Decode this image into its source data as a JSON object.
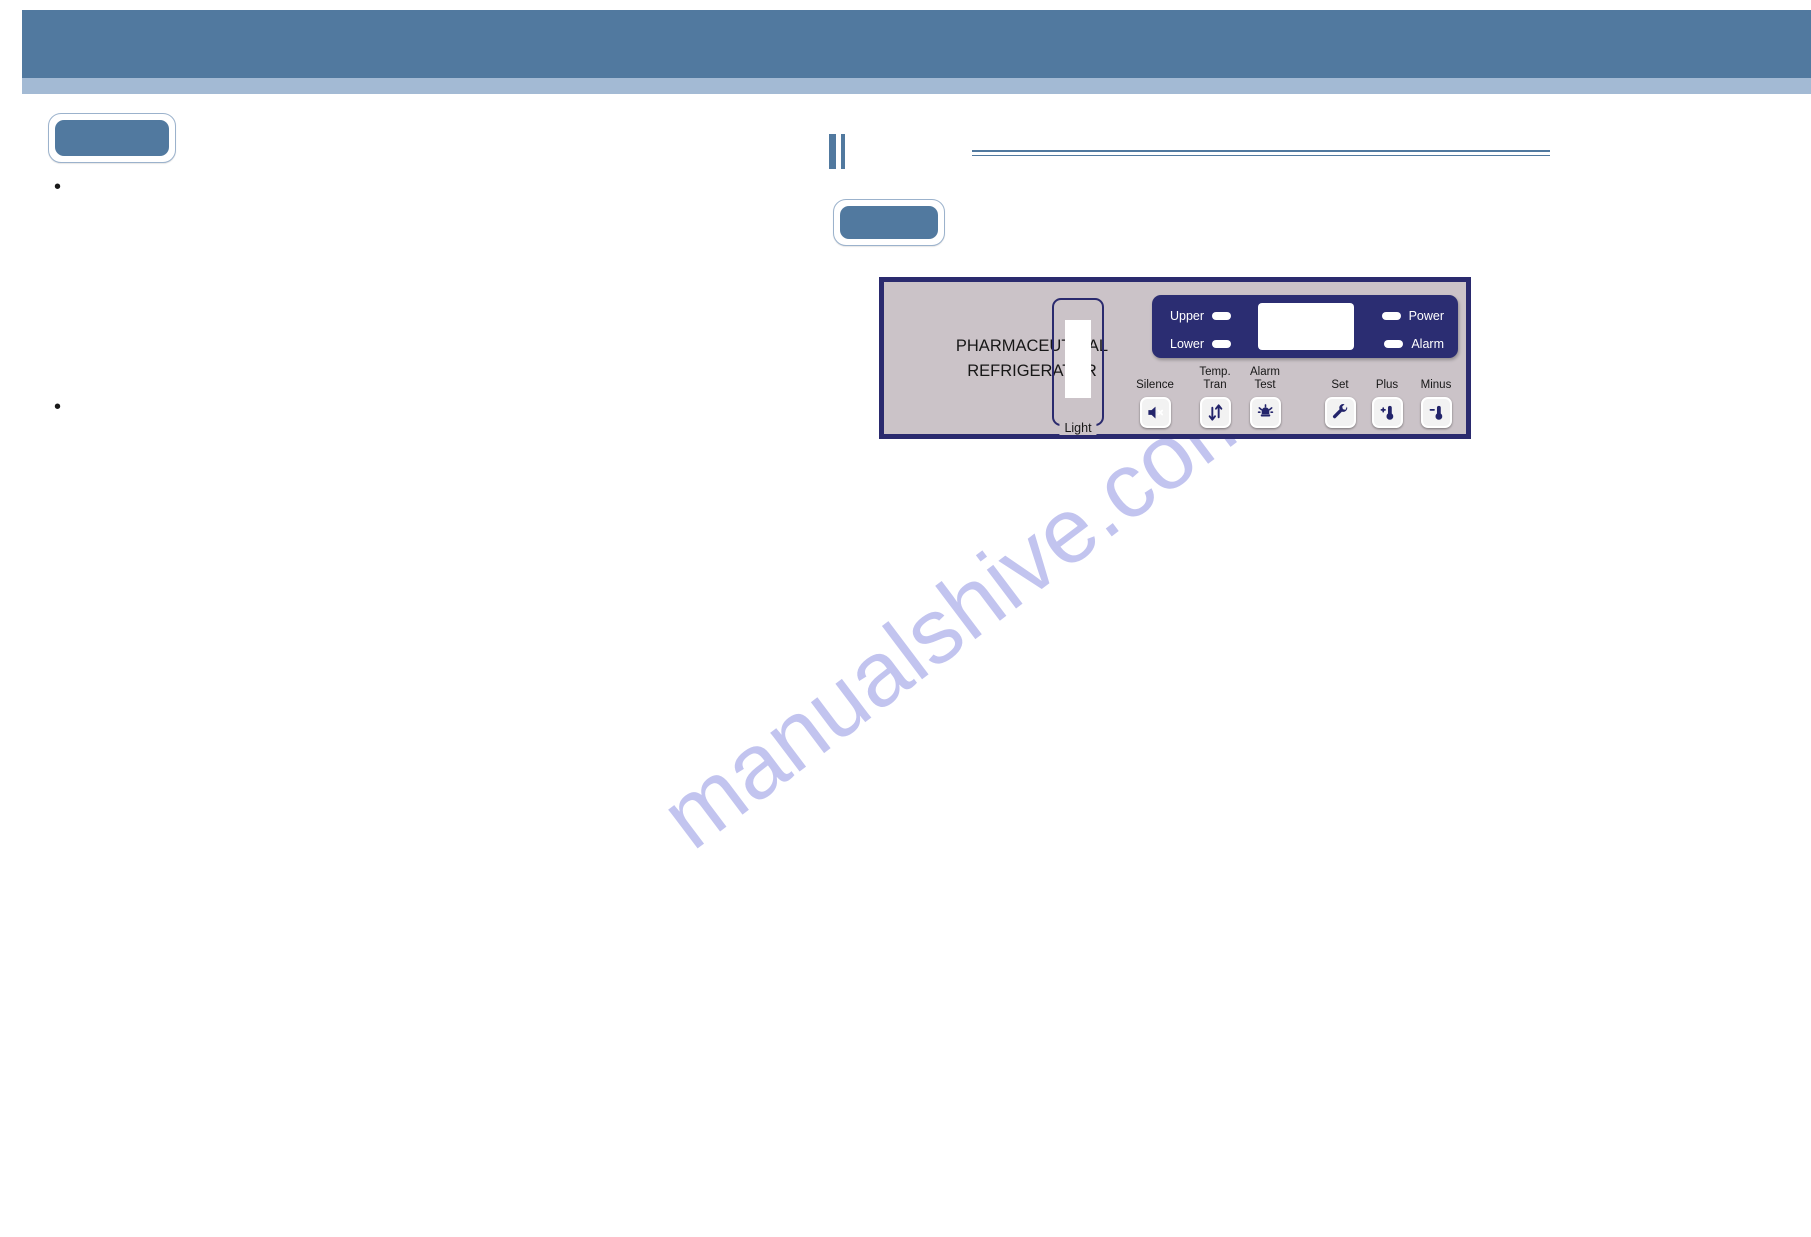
{
  "header": {
    "title": "",
    "band_color": "#51799f",
    "underband_color": "#a3bad4"
  },
  "watermark": {
    "text": "manualshive.com",
    "color": "#c2c4ef"
  },
  "left_column": {
    "chip_label": "",
    "bullets": [
      {
        "text": ""
      },
      {
        "text": ""
      }
    ]
  },
  "right_column": {
    "section_marker": "section-bars",
    "rule": "double-rule",
    "chip_label": ""
  },
  "control_panel": {
    "brand": "PHARMACEUTICAL\nREFRIGERATOR",
    "panel_color": "#cbc3c8",
    "border_color": "#2a2a6e",
    "display_color": "#2b2d72",
    "light_switch": {
      "legend": "Light"
    },
    "display": {
      "lcd_value": "",
      "indicators": [
        {
          "label": "Upper",
          "icon": "led-indicator"
        },
        {
          "label": "Lower",
          "icon": "led-indicator"
        },
        {
          "label": "Power",
          "icon": "led-indicator"
        },
        {
          "label": "Alarm",
          "icon": "led-indicator"
        }
      ]
    },
    "keys": [
      {
        "label": "Silence",
        "icon": "speaker-mute-icon"
      },
      {
        "label": "Temp.\nTran",
        "icon": "up-down-arrows-icon"
      },
      {
        "label": "Alarm\nTest",
        "icon": "alarm-siren-icon"
      },
      {
        "label": "Set",
        "icon": "wrench-icon"
      },
      {
        "label": "Plus",
        "icon": "thermometer-plus-icon"
      },
      {
        "label": "Minus",
        "icon": "thermometer-minus-icon"
      }
    ]
  }
}
